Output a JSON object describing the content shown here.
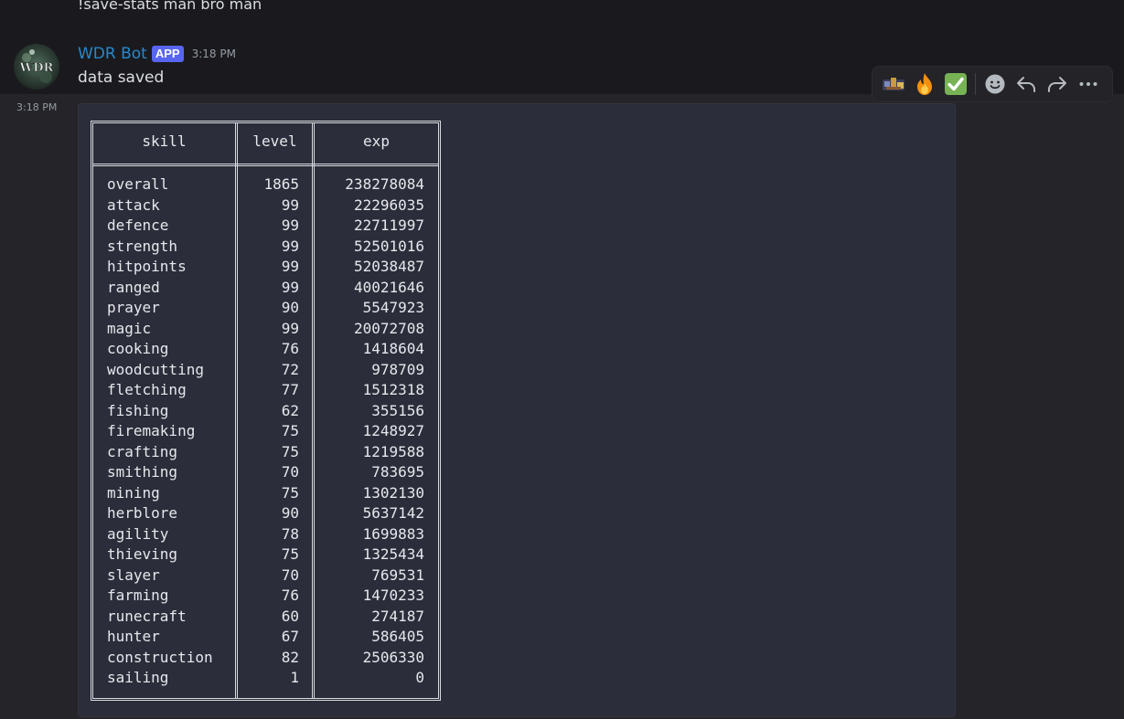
{
  "previous_message": {
    "text": "!save-stats man bro man"
  },
  "message": {
    "author": "WDR Bot",
    "badge": "APP",
    "timestamp": "3:18 PM",
    "content": "data saved",
    "avatar_text": "WDR",
    "followup_timestamp": "3:18 PM"
  },
  "toolbar": {
    "reactions": [
      {
        "icon": "custom-emoji-icon"
      },
      {
        "icon": "fire-emoji-icon",
        "glyph": "🔥"
      },
      {
        "icon": "check-mark-emoji-icon",
        "glyph": "✅"
      }
    ],
    "actions": [
      "add-reaction-icon",
      "reply-icon",
      "forward-icon",
      "more-icon"
    ]
  },
  "stats_table": {
    "headers": {
      "skill": "skill",
      "level": "level",
      "exp": "exp"
    },
    "rows": [
      {
        "skill": "overall",
        "level": "1865",
        "exp": "238278084"
      },
      {
        "skill": "attack",
        "level": "99",
        "exp": "22296035"
      },
      {
        "skill": "defence",
        "level": "99",
        "exp": "22711997"
      },
      {
        "skill": "strength",
        "level": "99",
        "exp": "52501016"
      },
      {
        "skill": "hitpoints",
        "level": "99",
        "exp": "52038487"
      },
      {
        "skill": "ranged",
        "level": "99",
        "exp": "40021646"
      },
      {
        "skill": "prayer",
        "level": "90",
        "exp": "5547923"
      },
      {
        "skill": "magic",
        "level": "99",
        "exp": "20072708"
      },
      {
        "skill": "cooking",
        "level": "76",
        "exp": "1418604"
      },
      {
        "skill": "woodcutting",
        "level": "72",
        "exp": "978709"
      },
      {
        "skill": "fletching",
        "level": "77",
        "exp": "1512318"
      },
      {
        "skill": "fishing",
        "level": "62",
        "exp": "355156"
      },
      {
        "skill": "firemaking",
        "level": "75",
        "exp": "1248927"
      },
      {
        "skill": "crafting",
        "level": "75",
        "exp": "1219588"
      },
      {
        "skill": "smithing",
        "level": "70",
        "exp": "783695"
      },
      {
        "skill": "mining",
        "level": "75",
        "exp": "1302130"
      },
      {
        "skill": "herblore",
        "level": "90",
        "exp": "5637142"
      },
      {
        "skill": "agility",
        "level": "78",
        "exp": "1699883"
      },
      {
        "skill": "thieving",
        "level": "75",
        "exp": "1325434"
      },
      {
        "skill": "slayer",
        "level": "70",
        "exp": "769531"
      },
      {
        "skill": "farming",
        "level": "76",
        "exp": "1470233"
      },
      {
        "skill": "runecraft",
        "level": "60",
        "exp": "274187"
      },
      {
        "skill": "hunter",
        "level": "67",
        "exp": "586405"
      },
      {
        "skill": "construction",
        "level": "82",
        "exp": "2506330"
      },
      {
        "skill": "sailing",
        "level": "1",
        "exp": "0"
      }
    ]
  },
  "colors": {
    "username": "#2a87c9",
    "badge": "#5865f2",
    "codeblock_bg": "#2b2d3a"
  }
}
